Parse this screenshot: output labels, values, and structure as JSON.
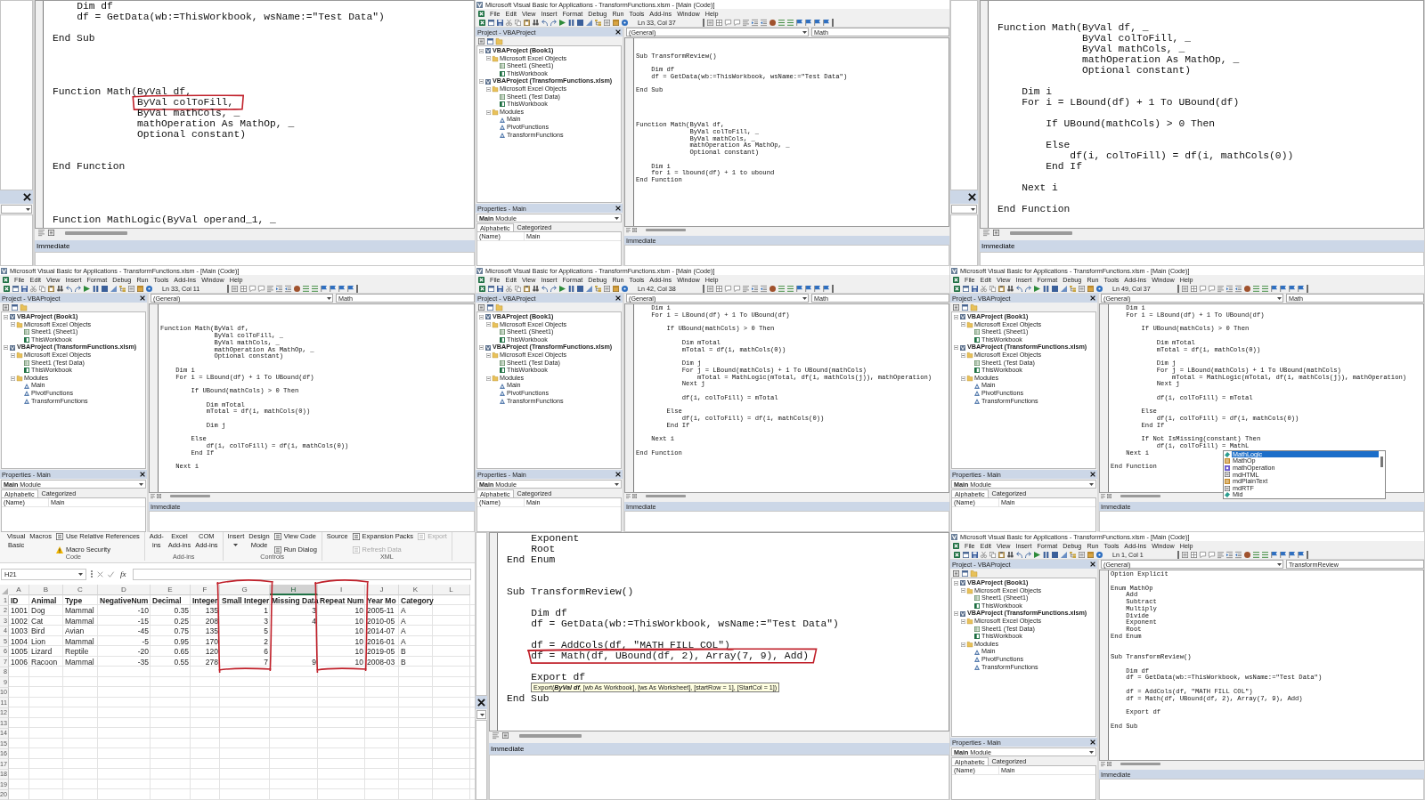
{
  "panels": [
    {
      "kind": "code_zoom",
      "code": [
        {
          "text": "    Dim df\n    df = GetData(wb:=ThisWorkbook, wsName:=\"Test Data\")\n\nEnd Sub\n\n\n\n\nFunction Math(ByVal df,"
        },
        {
          "text": "              ByVal colToFill,",
          "boxed": true
        },
        {
          "text": "              ByVal mathCols, _\n              mathOperation As MathOp, _\n              Optional constant)\n\n\nEnd Function\n\n\n\n\nFunction MathLogic(ByVal operand_1, _"
        }
      ],
      "immediate": "Immediate"
    },
    {
      "kind": "vbe",
      "title": "Microsoft Visual Basic for Applications - TransformFunctions.xlsm - [Main (Code)]",
      "menu": [
        "File",
        "Edit",
        "View",
        "Insert",
        "Format",
        "Debug",
        "Run",
        "Tools",
        "Add-Ins",
        "Window",
        "Help"
      ],
      "position": "Ln 33, Col 37",
      "project": {
        "title": "Project - VBAProject",
        "tree": [
          {
            "label": "VBAProject (Book1)",
            "kind": "project",
            "expanded": true,
            "children": [
              {
                "label": "Microsoft Excel Objects",
                "kind": "folder",
                "expanded": true,
                "children": [
                  {
                    "label": "Sheet1 (Sheet1)",
                    "kind": "sheet"
                  },
                  {
                    "label": "ThisWorkbook",
                    "kind": "workbook"
                  }
                ]
              }
            ]
          },
          {
            "label": "VBAProject (TransformFunctions.xlsm)",
            "kind": "project",
            "expanded": true,
            "children": [
              {
                "label": "Microsoft Excel Objects",
                "kind": "folder",
                "expanded": true,
                "children": [
                  {
                    "label": "Sheet1 (Test Data)",
                    "kind": "sheet"
                  },
                  {
                    "label": "ThisWorkbook",
                    "kind": "workbook"
                  }
                ]
              },
              {
                "label": "Modules",
                "kind": "folder",
                "expanded": true,
                "children": [
                  {
                    "label": "Main",
                    "kind": "module"
                  },
                  {
                    "label": "PivotFunctions",
                    "kind": "module"
                  },
                  {
                    "label": "TransformFunctions",
                    "kind": "module"
                  }
                ]
              }
            ]
          }
        ]
      },
      "properties": {
        "title": "Properties - Main",
        "object": "**Main** Module",
        "tabs": [
          {
            "label": "Alphabetic",
            "selected": true
          },
          {
            "label": "Categorized",
            "selected": false
          }
        ],
        "rows": [
          {
            "name": "(Name)",
            "value": "Main"
          }
        ]
      },
      "object_box": "(General)",
      "procedure_box": "Math",
      "code": [
        {
          "text": "\n\nSub TransformReview()\n\n    Dim df\n    df = GetData(wb:=ThisWorkbook, wsName:=\"Test Data\")\n\nEnd Sub\n\n\n\n\nFunction Math(ByVal df,\n              ByVal colToFill, _\n              ByVal mathCols, _\n              mathOperation As MathOp, _\n              Optional constant)\n\n    Dim i\n    for i = lbound(df) + 1 to ubound\nEnd Function"
        }
      ],
      "immediate": "Immediate"
    },
    {
      "kind": "code_zoom",
      "code": [
        {
          "text": "\n\nFunction Math(ByVal df, _\n              ByVal colToFill, _\n              ByVal mathCols, _\n              mathOperation As MathOp, _\n              Optional constant)\n\n    Dim i\n    For i = LBound(df) + 1 To UBound(df)\n\n        If UBound(mathCols) > 0 Then\n\n        Else\n            df(i, colToFill) = df(i, mathCols(0))\n        End If\n\n    Next i\n\nEnd Function"
        }
      ],
      "immediate": "Immediate"
    },
    {
      "kind": "vbe",
      "title": "Microsoft Visual Basic for Applications - TransformFunctions.xlsm - [Main (Code)]",
      "menu": [
        "File",
        "Edit",
        "View",
        "Insert",
        "Format",
        "Debug",
        "Run",
        "Tools",
        "Add-Ins",
        "Window",
        "Help"
      ],
      "position": "Ln 33, Col 11",
      "project": {
        "title": "Project - VBAProject",
        "tree": [
          {
            "label": "VBAProject (Book1)",
            "kind": "project",
            "expanded": true,
            "children": [
              {
                "label": "Microsoft Excel Objects",
                "kind": "folder",
                "expanded": true,
                "children": [
                  {
                    "label": "Sheet1 (Sheet1)",
                    "kind": "sheet"
                  },
                  {
                    "label": "ThisWorkbook",
                    "kind": "workbook"
                  }
                ]
              }
            ]
          },
          {
            "label": "VBAProject (TransformFunctions.xlsm)",
            "kind": "project",
            "expanded": true,
            "children": [
              {
                "label": "Microsoft Excel Objects",
                "kind": "folder",
                "expanded": true,
                "children": [
                  {
                    "label": "Sheet1 (Test Data)",
                    "kind": "sheet"
                  },
                  {
                    "label": "ThisWorkbook",
                    "kind": "workbook"
                  }
                ]
              },
              {
                "label": "Modules",
                "kind": "folder",
                "expanded": true,
                "children": [
                  {
                    "label": "Main",
                    "kind": "module"
                  },
                  {
                    "label": "PivotFunctions",
                    "kind": "module"
                  },
                  {
                    "label": "TransformFunctions",
                    "kind": "module"
                  }
                ]
              }
            ]
          }
        ]
      },
      "properties": {
        "title": "Properties - Main",
        "object": "**Main** Module",
        "tabs": [
          {
            "label": "Alphabetic",
            "selected": true
          },
          {
            "label": "Categorized",
            "selected": false
          }
        ],
        "rows": [
          {
            "name": "(Name)",
            "value": "Main"
          }
        ]
      },
      "object_box": "(General)",
      "procedure_box": "Math",
      "code": [
        {
          "text": "\n\n\nFunction Math(ByVal df,\n              ByVal colToFill, _\n              ByVal mathCols, _\n              mathOperation As MathOp, _\n              Optional constant)\n\n    Dim i\n    For i = LBound(df) + 1 To UBound(df)\n\n        If UBound(mathCols) > 0 Then\n\n            Dim mTotal\n            mTotal = df(i, mathCols(0))\n\n            Dim j\n\n        Else\n            df(i, colToFill) = df(i, mathCols(0))\n        End If\n\n    Next i"
        }
      ],
      "immediate": "Immediate"
    },
    {
      "kind": "vbe",
      "title": "Microsoft Visual Basic for Applications - TransformFunctions.xlsm - [Main (Code)]",
      "menu": [
        "File",
        "Edit",
        "View",
        "Insert",
        "Format",
        "Debug",
        "Run",
        "Tools",
        "Add-Ins",
        "Window",
        "Help"
      ],
      "position": "Ln 42, Col 38",
      "project": {
        "title": "Project - VBAProject",
        "tree": [
          {
            "label": "VBAProject (Book1)",
            "kind": "project",
            "expanded": true,
            "children": [
              {
                "label": "Microsoft Excel Objects",
                "kind": "folder",
                "expanded": true,
                "children": [
                  {
                    "label": "Sheet1 (Sheet1)",
                    "kind": "sheet"
                  },
                  {
                    "label": "ThisWorkbook",
                    "kind": "workbook"
                  }
                ]
              }
            ]
          },
          {
            "label": "VBAProject (TransformFunctions.xlsm)",
            "kind": "project",
            "expanded": true,
            "children": [
              {
                "label": "Microsoft Excel Objects",
                "kind": "folder",
                "expanded": true,
                "children": [
                  {
                    "label": "Sheet1 (Test Data)",
                    "kind": "sheet"
                  },
                  {
                    "label": "ThisWorkbook",
                    "kind": "workbook"
                  }
                ]
              },
              {
                "label": "Modules",
                "kind": "folder",
                "expanded": true,
                "children": [
                  {
                    "label": "Main",
                    "kind": "module"
                  },
                  {
                    "label": "PivotFunctions",
                    "kind": "module"
                  },
                  {
                    "label": "TransformFunctions",
                    "kind": "module"
                  }
                ]
              }
            ]
          }
        ]
      },
      "properties": {
        "title": "Properties - Main",
        "object": "**Main** Module",
        "tabs": [
          {
            "label": "Alphabetic",
            "selected": true
          },
          {
            "label": "Categorized",
            "selected": false
          }
        ],
        "rows": [
          {
            "name": "(Name)",
            "value": "Main"
          }
        ]
      },
      "object_box": "(General)",
      "procedure_box": "Math",
      "code": [
        {
          "text": "    Dim i\n    For i = LBound(df) + 1 To UBound(df)\n\n        If UBound(mathCols) > 0 Then\n\n            Dim mTotal\n            mTotal = df(i, mathCols(0))\n\n            Dim j\n            For j = LBound(mathCols) + 1 To UBound(mathCols)\n                mTotal = MathLogic(mTotal, df(i, mathCols(j)), mathOperation)\n            Next j\n\n            df(i, colToFill) = mTotal\n\n        Else\n            df(i, colToFill) = df(i, mathCols(0))\n        End If\n\n    Next i\n\nEnd Function"
        }
      ],
      "immediate": "Immediate"
    },
    {
      "kind": "vbe",
      "title": "Microsoft Visual Basic for Applications - TransformFunctions.xlsm - [Main (Code)]",
      "menu": [
        "File",
        "Edit",
        "View",
        "Insert",
        "Format",
        "Debug",
        "Run",
        "Tools",
        "Add-Ins",
        "Window",
        "Help"
      ],
      "position": "Ln 49, Col 37",
      "project": {
        "title": "Project - VBAProject",
        "tree": [
          {
            "label": "VBAProject (Book1)",
            "kind": "project",
            "expanded": true,
            "children": [
              {
                "label": "Microsoft Excel Objects",
                "kind": "folder",
                "expanded": true,
                "children": [
                  {
                    "label": "Sheet1 (Sheet1)",
                    "kind": "sheet"
                  },
                  {
                    "label": "ThisWorkbook",
                    "kind": "workbook"
                  }
                ]
              }
            ]
          },
          {
            "label": "VBAProject (TransformFunctions.xlsm)",
            "kind": "project",
            "expanded": true,
            "children": [
              {
                "label": "Microsoft Excel Objects",
                "kind": "folder",
                "expanded": true,
                "children": [
                  {
                    "label": "Sheet1 (Test Data)",
                    "kind": "sheet"
                  },
                  {
                    "label": "ThisWorkbook",
                    "kind": "workbook"
                  }
                ]
              },
              {
                "label": "Modules",
                "kind": "folder",
                "expanded": true,
                "children": [
                  {
                    "label": "Main",
                    "kind": "module"
                  },
                  {
                    "label": "PivotFunctions",
                    "kind": "module"
                  },
                  {
                    "label": "TransformFunctions",
                    "kind": "module"
                  }
                ]
              }
            ]
          }
        ]
      },
      "properties": {
        "title": "Properties - Main",
        "object": "**Main** Module",
        "tabs": [
          {
            "label": "Alphabetic",
            "selected": true
          },
          {
            "label": "Categorized",
            "selected": false
          }
        ],
        "rows": [
          {
            "name": "(Name)",
            "value": "Main"
          }
        ]
      },
      "object_box": "(General)",
      "procedure_box": "Math",
      "code": [
        {
          "text": "    Dim i\n    For i = LBound(df) + 1 To UBound(df)\n\n        If UBound(mathCols) > 0 Then\n\n            Dim mTotal\n            mTotal = df(i, mathCols(0))\n\n            Dim j\n            For j = LBound(mathCols) + 1 To UBound(mathCols)\n                mTotal = MathLogic(mTotal, df(i, mathCols(j)), mathOperation)\n            Next j\n\n            df(i, colToFill) = mTotal\n\n        Else\n            df(i, colToFill) = df(i, mathCols(0))\n        End If\n\n        If Not IsMissing(constant) Then"
        },
        {
          "text": "            df(i, colToFill) = MathL",
          "completion": [
            {
              "label": "MathLogic",
              "kind": "method",
              "selected": true
            },
            {
              "label": "MathOp",
              "kind": "enum",
              "selected": false
            },
            {
              "label": "mathOperation",
              "kind": "variable",
              "selected": false
            },
            {
              "label": "mdHTML",
              "kind": "constant",
              "selected": false
            },
            {
              "label": "mdPlainText",
              "kind": "enum",
              "selected": false
            },
            {
              "label": "mdRTF",
              "kind": "constant",
              "selected": false
            },
            {
              "label": "Mid",
              "kind": "method",
              "selected": false
            }
          ]
        },
        {
          "text": "    Next i\n\nEnd Function"
        }
      ],
      "immediate": "Immediate"
    },
    {
      "kind": "excel",
      "ribbon": [
        {
          "label": "Code",
          "items": [
            {
              "label": "Visual\nBasic",
              "kind": "large",
              "disabled": false
            },
            {
              "label": "Macros",
              "kind": "large",
              "disabled": false
            },
            {
              "label": "Use Relative References",
              "kind": "small",
              "disabled": false
            },
            {
              "label": "Macro Security",
              "kind": "warning",
              "disabled": false
            }
          ]
        },
        {
          "label": "Add-ins",
          "items": [
            {
              "label": "Add-\nins",
              "kind": "large",
              "disabled": false
            },
            {
              "label": "Excel\nAdd-ins",
              "kind": "large",
              "disabled": false
            },
            {
              "label": "COM\nAdd-ins",
              "kind": "large",
              "disabled": false
            }
          ]
        },
        {
          "label": "Controls",
          "items": [
            {
              "label": "Insert",
              "kind": "menu",
              "disabled": false
            },
            {
              "label": "Design\nMode",
              "kind": "large",
              "disabled": false
            },
            {
              "label": "View Code",
              "kind": "small",
              "disabled": false
            },
            {
              "label": "Run Dialog",
              "kind": "small",
              "disabled": false
            }
          ]
        },
        {
          "label": "XML",
          "items": [
            {
              "label": "Source",
              "kind": "large",
              "disabled": false
            },
            {
              "label": "Expansion Packs",
              "kind": "small",
              "disabled": false
            },
            {
              "label": "Refresh Data",
              "kind": "small",
              "disabled": true
            },
            {
              "label": "Export",
              "kind": "small",
              "disabled": true
            }
          ]
        }
      ],
      "name_box": "H21",
      "function_label": "fx",
      "columns": [
        {
          "letter": "A",
          "kind": "text",
          "selected": false
        },
        {
          "letter": "B",
          "kind": "text",
          "selected": false
        },
        {
          "letter": "C",
          "kind": "text",
          "selected": false
        },
        {
          "letter": "D",
          "kind": "number",
          "selected": false
        },
        {
          "letter": "E",
          "kind": "number",
          "selected": false
        },
        {
          "letter": "F",
          "kind": "number",
          "selected": false
        },
        {
          "letter": "G",
          "kind": "number",
          "selected": false,
          "boxed": true
        },
        {
          "letter": "H",
          "kind": "number",
          "selected": true
        },
        {
          "letter": "I",
          "kind": "number",
          "selected": false,
          "boxed": true
        },
        {
          "letter": "J",
          "kind": "text",
          "selected": false
        },
        {
          "letter": "K",
          "kind": "text",
          "selected": false
        },
        {
          "letter": "L",
          "kind": "text",
          "selected": false
        }
      ],
      "rows": [
        {
          "number": "1",
          "kind": "header",
          "cells": [
            "ID",
            "Animal",
            "Type",
            "NegativeNum",
            "Decimal",
            "Integer",
            "Small Integer",
            "Missing Data",
            "Repeat Num",
            "Year Mo",
            "Category",
            null
          ]
        },
        {
          "number": "2",
          "kind": "data",
          "cells": [
            "1001",
            "Dog",
            "Mammal",
            "-10",
            "0.35",
            "135",
            "1",
            "3",
            "10",
            "2005-11",
            "A",
            null
          ]
        },
        {
          "number": "3",
          "kind": "data",
          "cells": [
            "1002",
            "Cat",
            "Mammal",
            "-15",
            "0.25",
            "208",
            "3",
            "4",
            "10",
            "2010-05",
            "A",
            null
          ]
        },
        {
          "number": "4",
          "kind": "data",
          "cells": [
            "1003",
            "Bird",
            "Avian",
            "-45",
            "0.75",
            "135",
            "5",
            null,
            "10",
            "2014-07",
            "A",
            null
          ]
        },
        {
          "number": "5",
          "kind": "data",
          "cells": [
            "1004",
            "Lion",
            "Mammal",
            "-5",
            "0.95",
            "170",
            "2",
            null,
            "10",
            "2016-01",
            "A",
            null
          ]
        },
        {
          "number": "6",
          "kind": "data",
          "cells": [
            "1005",
            "Lizard",
            "Reptile",
            "-20",
            "0.65",
            "120",
            "6",
            null,
            "10",
            "2019-05",
            "B",
            null
          ]
        },
        {
          "number": "7",
          "kind": "data",
          "cells": [
            "1006",
            "Racoon",
            "Mammal",
            "-35",
            "0.55",
            "278",
            "7",
            "9",
            "10",
            "2008-03",
            "B",
            null
          ]
        },
        {
          "number": "8",
          "kind": "data"
        },
        {
          "number": "9",
          "kind": "data"
        },
        {
          "number": "10",
          "kind": "data"
        },
        {
          "number": "11",
          "kind": "data"
        },
        {
          "number": "12",
          "kind": "data"
        },
        {
          "number": "13",
          "kind": "data"
        },
        {
          "number": "14",
          "kind": "data"
        },
        {
          "number": "15",
          "kind": "data"
        },
        {
          "number": "16",
          "kind": "data"
        },
        {
          "number": "17",
          "kind": "data"
        },
        {
          "number": "18",
          "kind": "data"
        },
        {
          "number": "19",
          "kind": "data"
        },
        {
          "number": "20",
          "kind": "data"
        }
      ]
    },
    {
      "kind": "code_zoom",
      "code": [
        {
          "text": "    Exponent\n    Root\nEnd Enum\n\n\nSub TransformReview()\n\n    Dim df\n    df = GetData(wb:=ThisWorkbook, wsName:=\"Test Data\")\n"
        },
        {
          "text": "    df = AddCols(df, \"MATH FILL COL\")",
          "struck": true
        },
        {
          "text": "    df = Math(df, UBound(df, 2), Array(7, 9), Add)",
          "boxed": true
        },
        {
          "text": "\n    Export df",
          "tooltip": "Export(**ByVal df**, [wb As Workbook], [ws As Worksheet], [startRow = 1], [StartCol = 1])"
        },
        {
          "text": "\nEnd Sub"
        }
      ],
      "immediate": "Immediate"
    },
    {
      "kind": "vbe",
      "title": "Microsoft Visual Basic for Applications - TransformFunctions.xlsm - [Main (Code)]",
      "menu": [
        "File",
        "Edit",
        "View",
        "Insert",
        "Format",
        "Debug",
        "Run",
        "Tools",
        "Add-Ins",
        "Window",
        "Help"
      ],
      "position": "Ln 1, Col 1",
      "project": {
        "title": "Project - VBAProject",
        "tree": [
          {
            "label": "VBAProject (Book1)",
            "kind": "project",
            "expanded": true,
            "children": [
              {
                "label": "Microsoft Excel Objects",
                "kind": "folder",
                "expanded": true,
                "children": [
                  {
                    "label": "Sheet1 (Sheet1)",
                    "kind": "sheet"
                  },
                  {
                    "label": "ThisWorkbook",
                    "kind": "workbook"
                  }
                ]
              }
            ]
          },
          {
            "label": "VBAProject (TransformFunctions.xlsm)",
            "kind": "project",
            "expanded": true,
            "children": [
              {
                "label": "Microsoft Excel Objects",
                "kind": "folder",
                "expanded": true,
                "children": [
                  {
                    "label": "Sheet1 (Test Data)",
                    "kind": "sheet"
                  },
                  {
                    "label": "ThisWorkbook",
                    "kind": "workbook"
                  }
                ]
              },
              {
                "label": "Modules",
                "kind": "folder",
                "expanded": true,
                "children": [
                  {
                    "label": "Main",
                    "kind": "module"
                  },
                  {
                    "label": "PivotFunctions",
                    "kind": "module"
                  },
                  {
                    "label": "TransformFunctions",
                    "kind": "module"
                  }
                ]
              }
            ]
          }
        ]
      },
      "properties": {
        "title": "Properties - Main",
        "object": "**Main** Module",
        "tabs": [
          {
            "label": "Alphabetic",
            "selected": true
          },
          {
            "label": "Categorized",
            "selected": false
          }
        ],
        "rows": [
          {
            "name": "(Name)",
            "value": "Main"
          }
        ]
      },
      "object_box": "(General)",
      "procedure_box": "TransformReview",
      "code": [
        {
          "text": "Option Explicit\n\nEnum MathOp\n    Add\n    Subtract\n    Multiply\n    Divide\n    Exponent\n    Root\nEnd Enum\n\n\nSub TransformReview()\n\n    Dim df\n    df = GetData(wb:=ThisWorkbook, wsName:=\"Test Data\")\n\n    df = AddCols(df, \"MATH FILL COL\")\n    df = Math(df, UBound(df, 2), Array(7, 9), Add)\n\n    Export df\n\nEnd Sub"
        }
      ],
      "immediate": "Immediate"
    }
  ]
}
